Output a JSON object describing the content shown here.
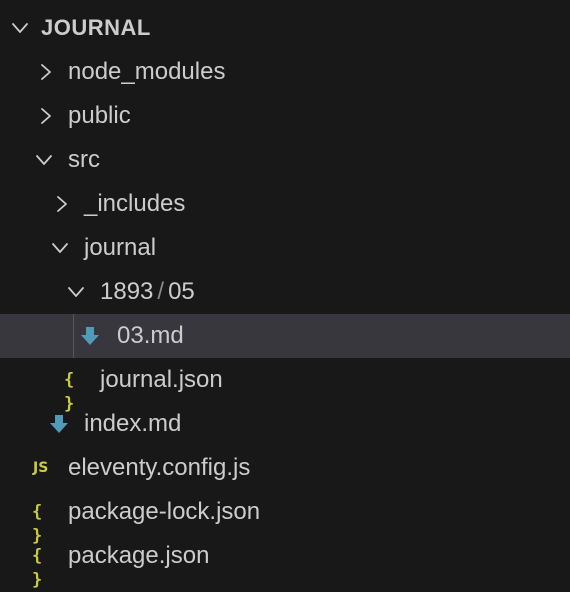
{
  "explorer": {
    "section_title": "JOURNAL",
    "items": [
      {
        "label": "node_modules",
        "type": "folder",
        "expanded": false,
        "depth": 0,
        "icon": "chevron-right-icon"
      },
      {
        "label": "public",
        "type": "folder",
        "expanded": false,
        "depth": 0,
        "icon": "chevron-right-icon"
      },
      {
        "label": "src",
        "type": "folder",
        "expanded": true,
        "depth": 0,
        "icon": "chevron-down-icon"
      },
      {
        "label": "_includes",
        "type": "folder",
        "expanded": false,
        "depth": 1,
        "icon": "chevron-right-icon"
      },
      {
        "label": "journal",
        "type": "folder",
        "expanded": true,
        "depth": 1,
        "icon": "chevron-down-icon"
      },
      {
        "label_parts": [
          "1893",
          "/",
          "05"
        ],
        "type": "folder",
        "expanded": true,
        "depth": 2,
        "icon": "chevron-down-icon"
      },
      {
        "label": "03.md",
        "type": "file",
        "depth": 3,
        "icon": "markdown-arrow-icon",
        "selected": true
      },
      {
        "label": "journal.json",
        "type": "file",
        "depth": 2,
        "icon": "json-braces-icon",
        "icon_text": "{ }"
      },
      {
        "label": "index.md",
        "type": "file",
        "depth": 1,
        "icon": "markdown-arrow-icon"
      },
      {
        "label": "eleventy.config.js",
        "type": "file",
        "depth": 0,
        "icon": "javascript-icon",
        "icon_text": "JS"
      },
      {
        "label": "package-lock.json",
        "type": "file",
        "depth": 0,
        "icon": "json-braces-icon",
        "icon_text": "{ }"
      },
      {
        "label": "package.json",
        "type": "file",
        "depth": 0,
        "icon": "json-braces-icon",
        "icon_text": "{ }"
      }
    ]
  },
  "colors": {
    "background": "#181818",
    "text": "#cccccc",
    "selection": "#37373d",
    "markdown_icon": "#519aba",
    "json_icon": "#cbcb41",
    "js_icon": "#cbcb41",
    "path_separator": "#8a8a8a"
  }
}
